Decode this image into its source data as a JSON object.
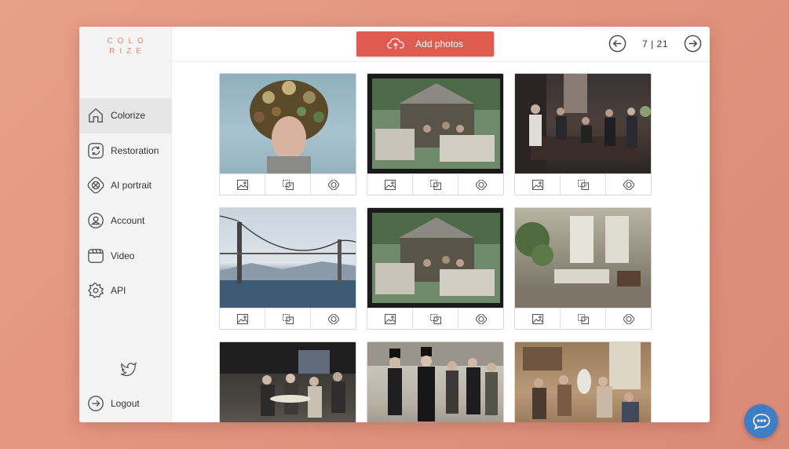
{
  "logo": {
    "line1": "COLO",
    "line2": "RIZE"
  },
  "sidebar": {
    "items": [
      {
        "label": "Colorize",
        "icon": "home-icon",
        "active": true
      },
      {
        "label": "Restoration",
        "icon": "restore-icon",
        "active": false
      },
      {
        "label": "AI portrait",
        "icon": "ai-portrait-icon",
        "active": false
      },
      {
        "label": "Account",
        "icon": "user-icon",
        "active": false
      },
      {
        "label": "Video",
        "icon": "video-icon",
        "active": false
      },
      {
        "label": "API",
        "icon": "gear-icon",
        "active": false
      }
    ],
    "social_icon": "twitter-icon",
    "logout_label": "Logout",
    "logout_icon": "logout-icon"
  },
  "toolbar": {
    "add_label": "Add photos",
    "add_icon": "cloud-upload-icon"
  },
  "pager": {
    "current": "7",
    "separator": "|",
    "total": "21",
    "prev_icon": "arrow-left-circle-icon",
    "next_icon": "arrow-right-circle-icon"
  },
  "photos": [
    {
      "subject": "girl-with-floral-headdress"
    },
    {
      "subject": "gypsy-camp"
    },
    {
      "subject": "group-seated-room"
    },
    {
      "subject": "golden-gate-bridge-construction"
    },
    {
      "subject": "gypsy-camp"
    },
    {
      "subject": "victorian-parlor"
    },
    {
      "subject": "women-at-cafe"
    },
    {
      "subject": "boys-in-top-hats"
    },
    {
      "subject": "family-interior"
    }
  ],
  "card_actions": [
    "image-icon",
    "crop-resize-icon",
    "aperture-icon"
  ],
  "chat_icon": "chat-bubble-icon",
  "colors": {
    "accent": "#de5b52",
    "logo": "#e0886f",
    "chat": "#3d7ec7",
    "background": "#e39680"
  }
}
